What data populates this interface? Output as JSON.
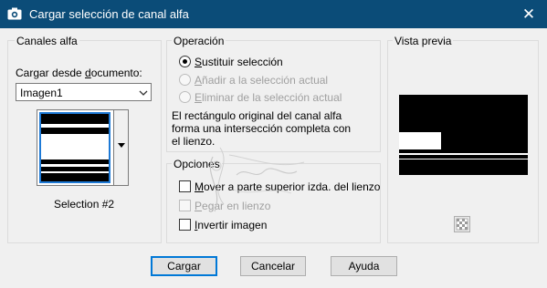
{
  "window": {
    "title": "Cargar selección de canal alfa",
    "close_glyph": "✕"
  },
  "alpha": {
    "group_title": "Canales alfa",
    "source_label_pre": "Cargar desde ",
    "source_label_u": "d",
    "source_label_post": "ocumento:",
    "document_value": "Imagen1",
    "channel_name": "Selection #2"
  },
  "operation": {
    "group_title": "Operación",
    "options": [
      {
        "u": "S",
        "rest": "ustituir selección",
        "selected": true,
        "enabled": true
      },
      {
        "u": "A",
        "rest": "ñadir a la selección actual",
        "selected": false,
        "enabled": false
      },
      {
        "u": "E",
        "rest": "liminar de la selección actual",
        "selected": false,
        "enabled": false
      }
    ],
    "description": "El rectángulo original del canal alfa forma una intersección completa con el lienzo."
  },
  "options": {
    "group_title": "Opciones",
    "items": [
      {
        "u": "M",
        "rest": "over a parte superior izda. del lienzo",
        "checked": false,
        "enabled": true
      },
      {
        "u": "P",
        "rest": "egar en lienzo",
        "checked": false,
        "enabled": false
      },
      {
        "u": "I",
        "rest": "nvertir imagen",
        "checked": false,
        "enabled": true
      }
    ]
  },
  "preview": {
    "group_title": "Vista previa",
    "toggle_icon": "checkerboard-icon"
  },
  "buttons": {
    "ok": "Cargar",
    "cancel": "Cancelar",
    "help": "Ayuda"
  },
  "colors": {
    "titlebar": "#0b4c78",
    "accent": "#0078d7"
  }
}
